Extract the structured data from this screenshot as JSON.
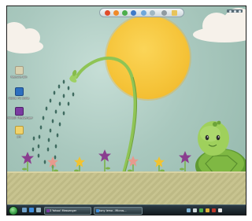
{
  "toolbar": {
    "icons": [
      "windows-flag-icon",
      "mail-icon",
      "messenger-icon",
      "media-player-icon",
      "internet-explorer-icon",
      "help-icon",
      "tool-icon",
      "folder-icon"
    ]
  },
  "desktop": {
    "icons": [
      {
        "label": "Recycle Bin",
        "icon": "recycle-bin-icon",
        "color": "#d9d2b0"
      },
      {
        "label": "Nokia PC Suite",
        "icon": "nokia-pc-suite-icon",
        "color": "#2d6fbf"
      },
      {
        "label": "Yahoo! Messenger",
        "icon": "yahoo-messenger-icon",
        "color": "#7a3aa1"
      },
      {
        "label": "cm",
        "icon": "folder-icon",
        "color": "#f1d36b"
      }
    ]
  },
  "taskbar": {
    "buttons": [
      {
        "label": "3 Yahoo! Messenger",
        "icon": "yahoo-messenger-icon",
        "color": "#7a3aa1"
      },
      {
        "label": "tony lema - Micros...",
        "icon": "internet-explorer-icon",
        "color": "#3f8ede"
      }
    ],
    "tray_icons": [
      "network-icon",
      "volume-icon",
      "messenger-tray-icon",
      "shield-icon",
      "clock-icon"
    ],
    "clock": ""
  },
  "colors": {
    "sun": "#f5c338",
    "sky": "#a9c8be",
    "ground": "#c8c490",
    "taskbar": "#1a242a",
    "turtle": "#8ec64b"
  }
}
